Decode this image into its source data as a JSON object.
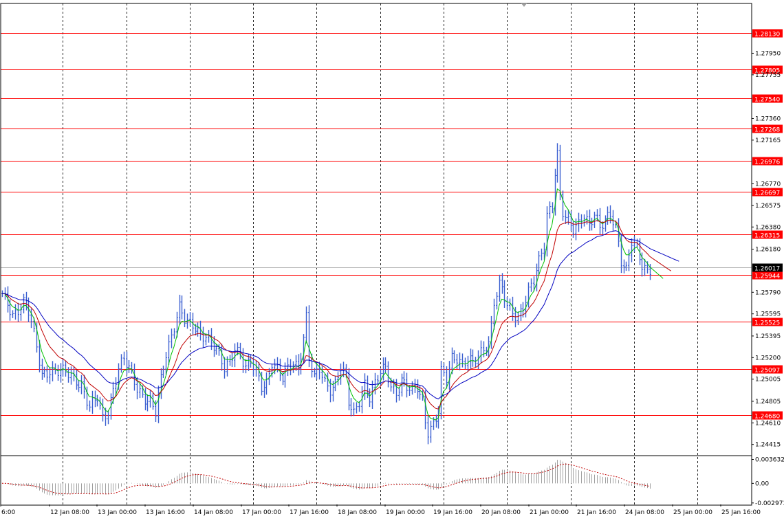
{
  "window": {
    "background": "#ffffff",
    "frame_color": "#000000",
    "grid_color": "#000000"
  },
  "chart_data": [
    {
      "type": "line",
      "instrument_style": "bars",
      "ylim": [
        1.2432,
        1.284
      ],
      "grid": true,
      "y_ticks": [
        "1.27950",
        "1.27755",
        "1.27360",
        "1.27165",
        "1.26770",
        "1.26575",
        "1.26380",
        "1.26180",
        "1.25790",
        "1.25595",
        "1.25395",
        "1.25200",
        "1.25005",
        "1.24805",
        "1.24610",
        "1.24415"
      ],
      "y_tick_values": [
        1.2795,
        1.27755,
        1.2736,
        1.27165,
        1.2677,
        1.26575,
        1.2638,
        1.2618,
        1.2579,
        1.25595,
        1.25395,
        1.252,
        1.25005,
        1.24805,
        1.2461,
        1.24415
      ],
      "x_labels": [
        "6:00",
        "12 Jan 08:00",
        "13 Jan 00:00",
        "13 Jan 16:00",
        "14 Jan 08:00",
        "17 Jan 00:00",
        "17 Jan 16:00",
        "18 Jan 08:00",
        "19 Jan 00:00",
        "19 Jan 16:00",
        "20 Jan 08:00",
        "21 Jan 00:00",
        "21 Jan 16:00",
        "24 Jan 08:00",
        "25 Jan 00:00",
        "25 Jan 16:00"
      ],
      "x_label_index": [
        0,
        16,
        32,
        48,
        64,
        80,
        96,
        112,
        128,
        144,
        160,
        176,
        192,
        208,
        224,
        240
      ],
      "vertical_grid_index": [
        23,
        47,
        71,
        95,
        119,
        143,
        167,
        191,
        215,
        239,
        263
      ],
      "total_slots": 284,
      "current_price": {
        "label": "1.26017",
        "value": 1.26017,
        "color": "#000000"
      },
      "levels": [
        {
          "label": "1.28130",
          "value": 1.2813
        },
        {
          "label": "1.27805",
          "value": 1.27805
        },
        {
          "label": "1.27540",
          "value": 1.2754
        },
        {
          "label": "1.27268",
          "value": 1.27268
        },
        {
          "label": "1.26976",
          "value": 1.26976
        },
        {
          "label": "1.26697",
          "value": 1.26697
        },
        {
          "label": "1.26315",
          "value": 1.26315
        },
        {
          "label": "1.25944",
          "value": 1.25944
        },
        {
          "label": "1.25525",
          "value": 1.25525
        },
        {
          "label": "1.25097",
          "value": 1.25097
        },
        {
          "label": "1.24680",
          "value": 1.2468
        }
      ],
      "level_color": "#ff0000",
      "price_path": [
        [
          0,
          1.2575
        ],
        [
          4,
          1.2558
        ],
        [
          8,
          1.2572
        ],
        [
          10,
          1.2562
        ],
        [
          13,
          1.2528
        ],
        [
          15,
          1.2503
        ],
        [
          18,
          1.251
        ],
        [
          22,
          1.2508
        ],
        [
          26,
          1.2502
        ],
        [
          30,
          1.2497
        ],
        [
          33,
          1.2476
        ],
        [
          36,
          1.2482
        ],
        [
          38,
          1.2463
        ],
        [
          40,
          1.2472
        ],
        [
          42,
          1.2493
        ],
        [
          44,
          1.2512
        ],
        [
          46,
          1.2518
        ],
        [
          48,
          1.2508
        ],
        [
          51,
          1.2492
        ],
        [
          54,
          1.2485
        ],
        [
          56,
          1.2482
        ],
        [
          58,
          1.247
        ],
        [
          60,
          1.2498
        ],
        [
          62,
          1.2522
        ],
        [
          64,
          1.254
        ],
        [
          66,
          1.256
        ],
        [
          67,
          1.2568
        ],
        [
          69,
          1.2555
        ],
        [
          71,
          1.2548
        ],
        [
          73,
          1.2545
        ],
        [
          75,
          1.254
        ],
        [
          77,
          1.2542
        ],
        [
          80,
          1.2532
        ],
        [
          82,
          1.252
        ],
        [
          84,
          1.2508
        ],
        [
          86,
          1.2515
        ],
        [
          88,
          1.253
        ],
        [
          90,
          1.2525
        ],
        [
          92,
          1.2512
        ],
        [
          94,
          1.2515
        ],
        [
          96,
          1.2505
        ],
        [
          98,
          1.2493
        ],
        [
          100,
          1.2498
        ],
        [
          102,
          1.2518
        ],
        [
          104,
          1.251
        ],
        [
          106,
          1.25
        ],
        [
          108,
          1.2508
        ],
        [
          110,
          1.2515
        ],
        [
          112,
          1.2512
        ],
        [
          114,
          1.254
        ],
        [
          115,
          1.2558
        ],
        [
          116,
          1.252
        ],
        [
          118,
          1.25
        ],
        [
          120,
          1.2508
        ],
        [
          122,
          1.2497
        ],
        [
          124,
          1.2493
        ],
        [
          126,
          1.2498
        ],
        [
          128,
          1.2512
        ],
        [
          130,
          1.25
        ],
        [
          131,
          1.2478
        ],
        [
          133,
          1.2468
        ],
        [
          135,
          1.2482
        ],
        [
          137,
          1.2498
        ],
        [
          139,
          1.2485
        ],
        [
          141,
          1.2495
        ],
        [
          143,
          1.2505
        ],
        [
          145,
          1.251
        ],
        [
          147,
          1.2495
        ],
        [
          149,
          1.249
        ],
        [
          151,
          1.25
        ],
        [
          153,
          1.2492
        ],
        [
          155,
          1.2488
        ],
        [
          157,
          1.2493
        ],
        [
          159,
          1.2482
        ],
        [
          160,
          1.2465
        ],
        [
          161,
          1.2455
        ],
        [
          163,
          1.246
        ],
        [
          165,
          1.247
        ],
        [
          166,
          1.2505
        ],
        [
          168,
          1.25
        ],
        [
          170,
          1.252
        ],
        [
          172,
          1.2522
        ],
        [
          174,
          1.2515
        ],
        [
          176,
          1.2518
        ],
        [
          178,
          1.2513
        ],
        [
          180,
          1.252
        ],
        [
          182,
          1.2528
        ],
        [
          184,
          1.2535
        ],
        [
          185,
          1.255
        ],
        [
          186,
          1.2572
        ],
        [
          188,
          1.2585
        ],
        [
          189,
          1.258
        ],
        [
          191,
          1.2565
        ],
        [
          193,
          1.256
        ],
        [
          195,
          1.2558
        ],
        [
          197,
          1.2568
        ],
        [
          199,
          1.258
        ],
        [
          201,
          1.2588
        ],
        [
          203,
          1.2605
        ],
        [
          205,
          1.2622
        ],
        [
          206,
          1.265
        ],
        [
          208,
          1.266
        ],
        [
          209,
          1.269
        ],
        [
          210,
          1.2705
        ],
        [
          211,
          1.2665
        ],
        [
          212,
          1.265
        ],
        [
          214,
          1.264
        ],
        [
          216,
          1.2635
        ],
        [
          218,
          1.2642
        ],
        [
          220,
          1.2652
        ],
        [
          222,
          1.264
        ],
        [
          224,
          1.2648
        ],
        [
          226,
          1.2635
        ],
        [
          228,
          1.2643
        ],
        [
          230,
          1.2652
        ],
        [
          232,
          1.264
        ],
        [
          233,
          1.2625
        ],
        [
          234,
          1.2608
        ],
        [
          236,
          1.2597
        ],
        [
          238,
          1.2623
        ],
        [
          240,
          1.2618
        ],
        [
          242,
          1.2605
        ],
        [
          244,
          1.26
        ],
        [
          245,
          1.2601
        ]
      ],
      "series": [
        {
          "color": "#00c000",
          "window": 5,
          "last_index": 250
        },
        {
          "color": "#c00000",
          "window": 13,
          "last_index": 253
        },
        {
          "color": "#0000c0",
          "window": 28,
          "last_index": 256
        }
      ]
    },
    {
      "type": "bar",
      "ylim": [
        -0.0032,
        0.004
      ],
      "y_ticks": [
        "0.003632",
        "0.00",
        "-0.002973"
      ],
      "y_tick_values": [
        0.003632,
        0.0,
        -0.002973
      ],
      "histogram_color": "#a0a0a0",
      "signal_color": "#c00000"
    }
  ]
}
